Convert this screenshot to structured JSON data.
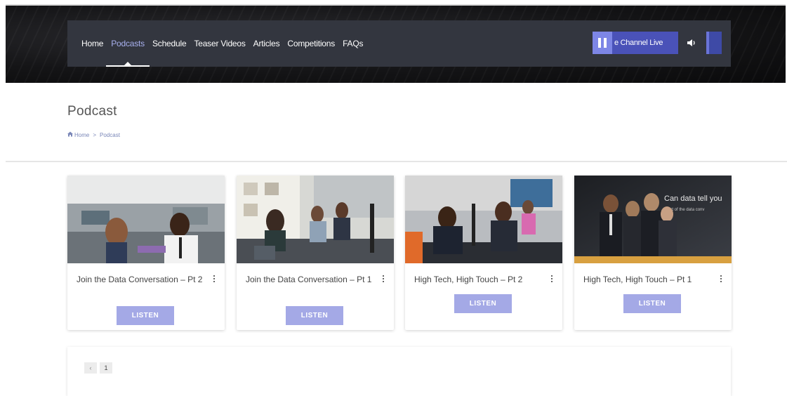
{
  "nav": {
    "items": [
      {
        "label": "Home",
        "active": false
      },
      {
        "label": "Podcasts",
        "active": true
      },
      {
        "label": "Schedule",
        "active": false
      },
      {
        "label": "Teaser Videos",
        "active": false
      },
      {
        "label": "Articles",
        "active": false
      },
      {
        "label": "Competitions",
        "active": false
      },
      {
        "label": "FAQs",
        "active": false
      }
    ]
  },
  "player": {
    "live_label": "e Channel Live",
    "pause_icon": "pause-icon",
    "volume_icon": "volume-icon"
  },
  "page": {
    "title": "Podcast",
    "breadcrumb": {
      "home_icon": "home-icon",
      "home": "Home",
      "separator": ">",
      "current": "Podcast"
    }
  },
  "cards": [
    {
      "title": "Join the Data Conversation – Pt 2",
      "listen_label": "LISTEN"
    },
    {
      "title": "Join the Data Conversation – Pt 1",
      "listen_label": "LISTEN"
    },
    {
      "title": "High Tech, High Touch – Pt 2",
      "listen_label": "LISTEN"
    },
    {
      "title": "High Tech, High Touch – Pt 1",
      "listen_label": "LISTEN"
    }
  ],
  "card4_overlay": {
    "line1": "Can data tell you",
    "line2": "art of the data conv"
  },
  "pagination": {
    "prev": "‹",
    "current_page": "1"
  },
  "colors": {
    "accent": "#a4a9e6",
    "nav_bg": "#33363f",
    "active_nav": "#a8b0ee",
    "live_bg": "#4a52b8"
  }
}
